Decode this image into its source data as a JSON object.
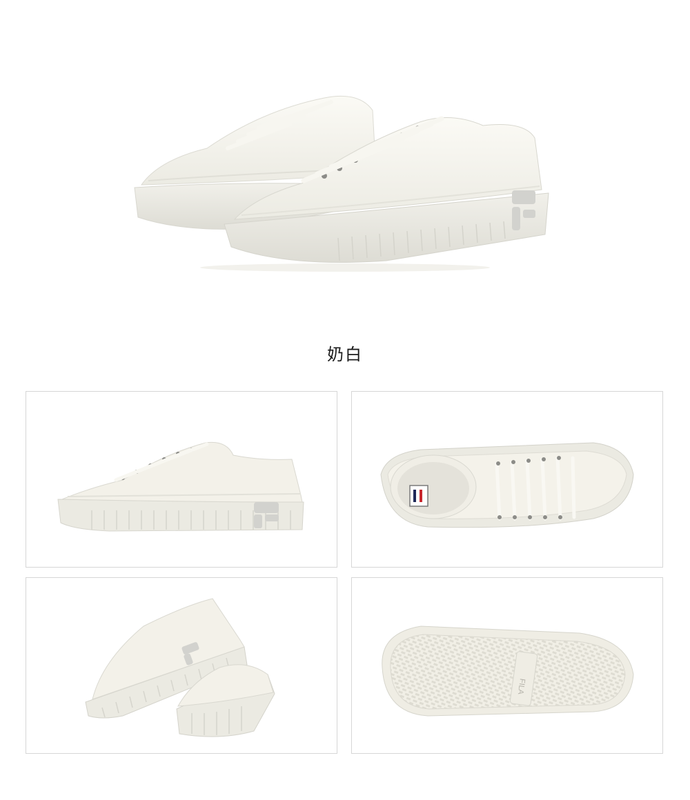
{
  "product": {
    "color_label": "奶白",
    "brand_mark": "FILA"
  },
  "colors": {
    "canvas": "#f3f1e9",
    "sole": "#ebeae2",
    "lace": "#f7f6f0",
    "badge": "#d2d2ce",
    "border": "#d6d6d6"
  },
  "views": [
    {
      "name": "hero-pair-view"
    },
    {
      "name": "side-profile-view"
    },
    {
      "name": "top-down-view"
    },
    {
      "name": "rear-pair-view"
    },
    {
      "name": "outsole-view"
    }
  ]
}
